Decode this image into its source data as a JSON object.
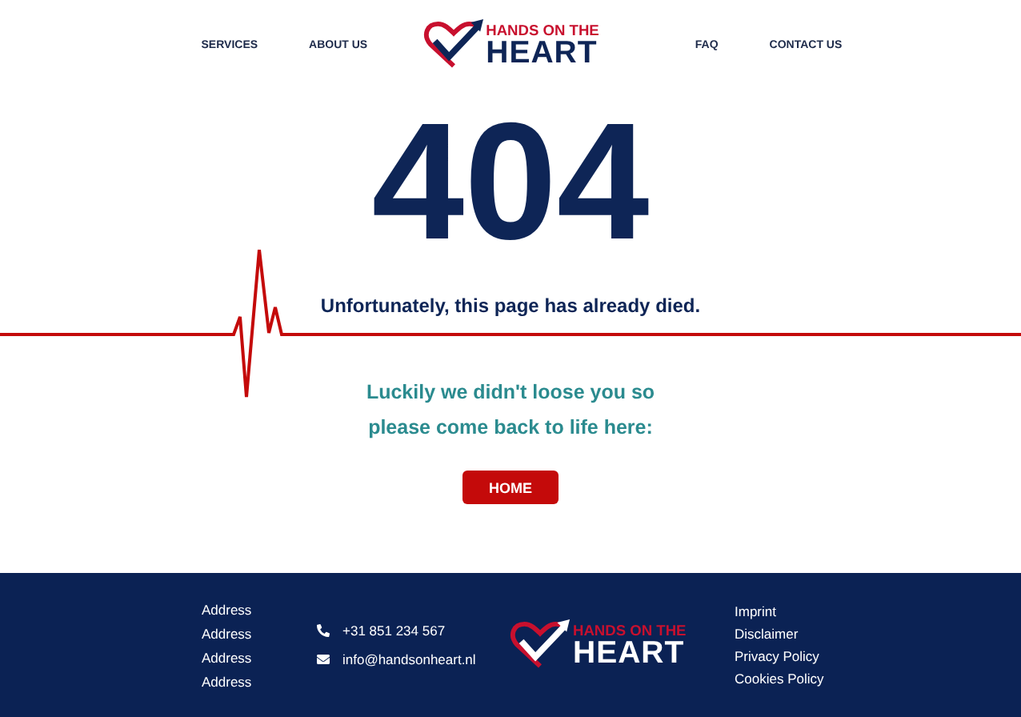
{
  "nav": {
    "left": [
      "SERVICES",
      "ABOUT US"
    ],
    "right": [
      "FAQ",
      "CONTACT US"
    ]
  },
  "logo": {
    "top": "HANDS ON THE",
    "bottom": "HEART"
  },
  "error": {
    "code": "404",
    "message": "Unfortunately, this page has already died.",
    "lines": [
      "Luckily we didn't loose you so",
      "please come back to life here:"
    ],
    "button": "HOME"
  },
  "footer": {
    "addresses": [
      "Address",
      "Address",
      "Address",
      "Address"
    ],
    "contacts": [
      {
        "kind": "phone",
        "text": "+31 851 234 567"
      },
      {
        "kind": "mail",
        "text": "info@handsonheart.nl"
      }
    ],
    "logo": {
      "top": "HANDS ON THE",
      "bottom": "HEART"
    },
    "links": [
      "Imprint",
      "Disclaimer",
      "Privacy Policy",
      "Cookies Policy"
    ]
  }
}
